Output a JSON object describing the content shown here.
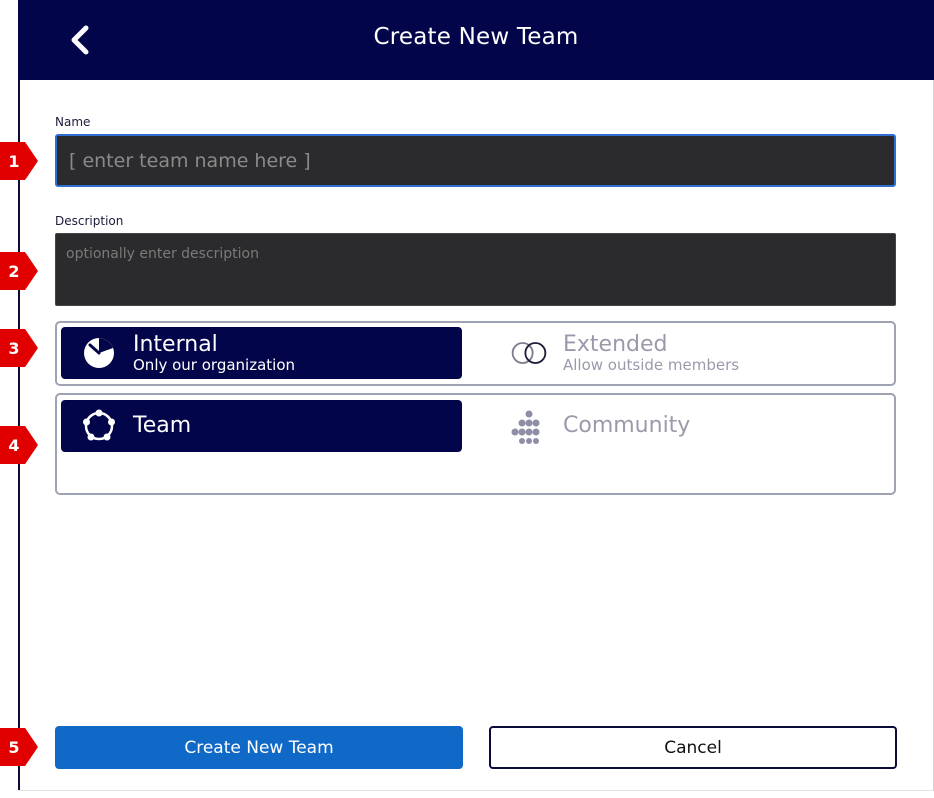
{
  "header": {
    "title": "Create New Team"
  },
  "form": {
    "name_label": "Name",
    "name_placeholder": "[ enter team name here ]",
    "name_value": "",
    "description_label": "Description",
    "description_placeholder": "optionally enter description",
    "description_value": ""
  },
  "access_toggle": {
    "selected": "internal",
    "options": [
      {
        "id": "internal",
        "title": "Internal",
        "subtitle": "Only our organization",
        "icon": "pie-clock-icon"
      },
      {
        "id": "extended",
        "title": "Extended",
        "subtitle": "Allow outside members",
        "icon": "overlapping-circles-icon"
      }
    ]
  },
  "type_toggle": {
    "selected": "team",
    "options": [
      {
        "id": "team",
        "title": "Team",
        "icon": "team-circle-icon"
      },
      {
        "id": "community",
        "title": "Community",
        "icon": "community-dots-icon"
      }
    ]
  },
  "actions": {
    "create_label": "Create New Team",
    "cancel_label": "Cancel"
  },
  "annotations": [
    "1",
    "2",
    "3",
    "4",
    "5"
  ],
  "colors": {
    "header_bg": "#03054a",
    "selected_bg": "#03054a",
    "primary": "#1169c7",
    "input_bg": "#2b2b2d",
    "input_focus": "#2f6fd1",
    "badge": "#e00000"
  }
}
